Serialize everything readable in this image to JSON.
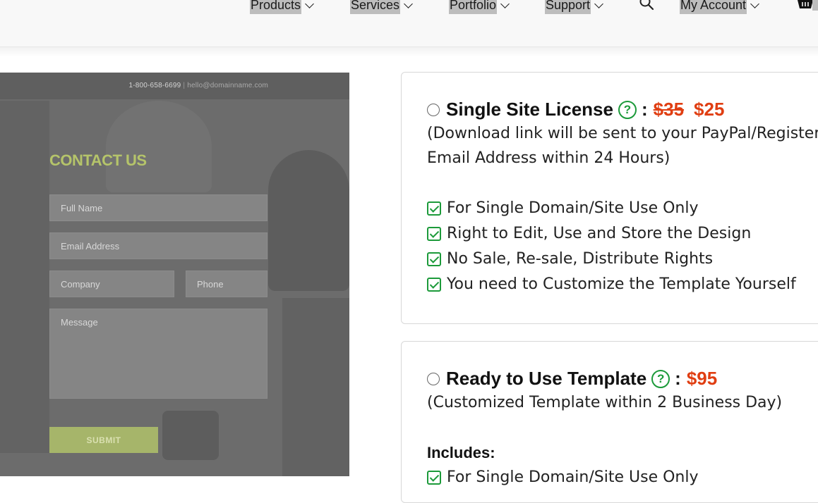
{
  "nav": {
    "items": [
      {
        "label": "Products"
      },
      {
        "label": "Services"
      },
      {
        "label": "Portfolio"
      },
      {
        "label": "Support"
      },
      {
        "label": "My Account"
      }
    ],
    "search_icon": "search-icon",
    "cart_icon": "shopping-basket-icon"
  },
  "preview": {
    "phone": "1-800-658-6699",
    "separator": "|",
    "email": "hello@domainname.com",
    "title": "CONTACT US",
    "fields": {
      "full_name": "Full Name",
      "email": "Email Address",
      "company": "Company",
      "phone": "Phone",
      "message": "Message"
    },
    "submit_label": "SUBMIT",
    "accent_color": "#b5c46a"
  },
  "licenses": [
    {
      "name": "Single Site License",
      "help_icon": "?",
      "colon": ":",
      "old_price": "$35",
      "price": "$25",
      "desc_line1": "(Download link will be sent to your PayPal/Registered",
      "desc_line2": "Email Address within 24 Hours)",
      "features": [
        "For Single Domain/Site Use Only",
        "Right to Edit, Use and Store the Design",
        "No Sale, Re-sale, Distribute Rights",
        "You need to Customize the Template Yourself"
      ]
    },
    {
      "name": "Ready to Use Template",
      "help_icon": "?",
      "colon": ":",
      "price": "$95",
      "desc_line1": "(Customized Template within 2 Business Day)",
      "includes_label": "Includes:",
      "features": [
        "For Single Domain/Site Use Only"
      ]
    }
  ],
  "colors": {
    "price_red": "#e03e12",
    "check_green": "#1c9a3a"
  }
}
